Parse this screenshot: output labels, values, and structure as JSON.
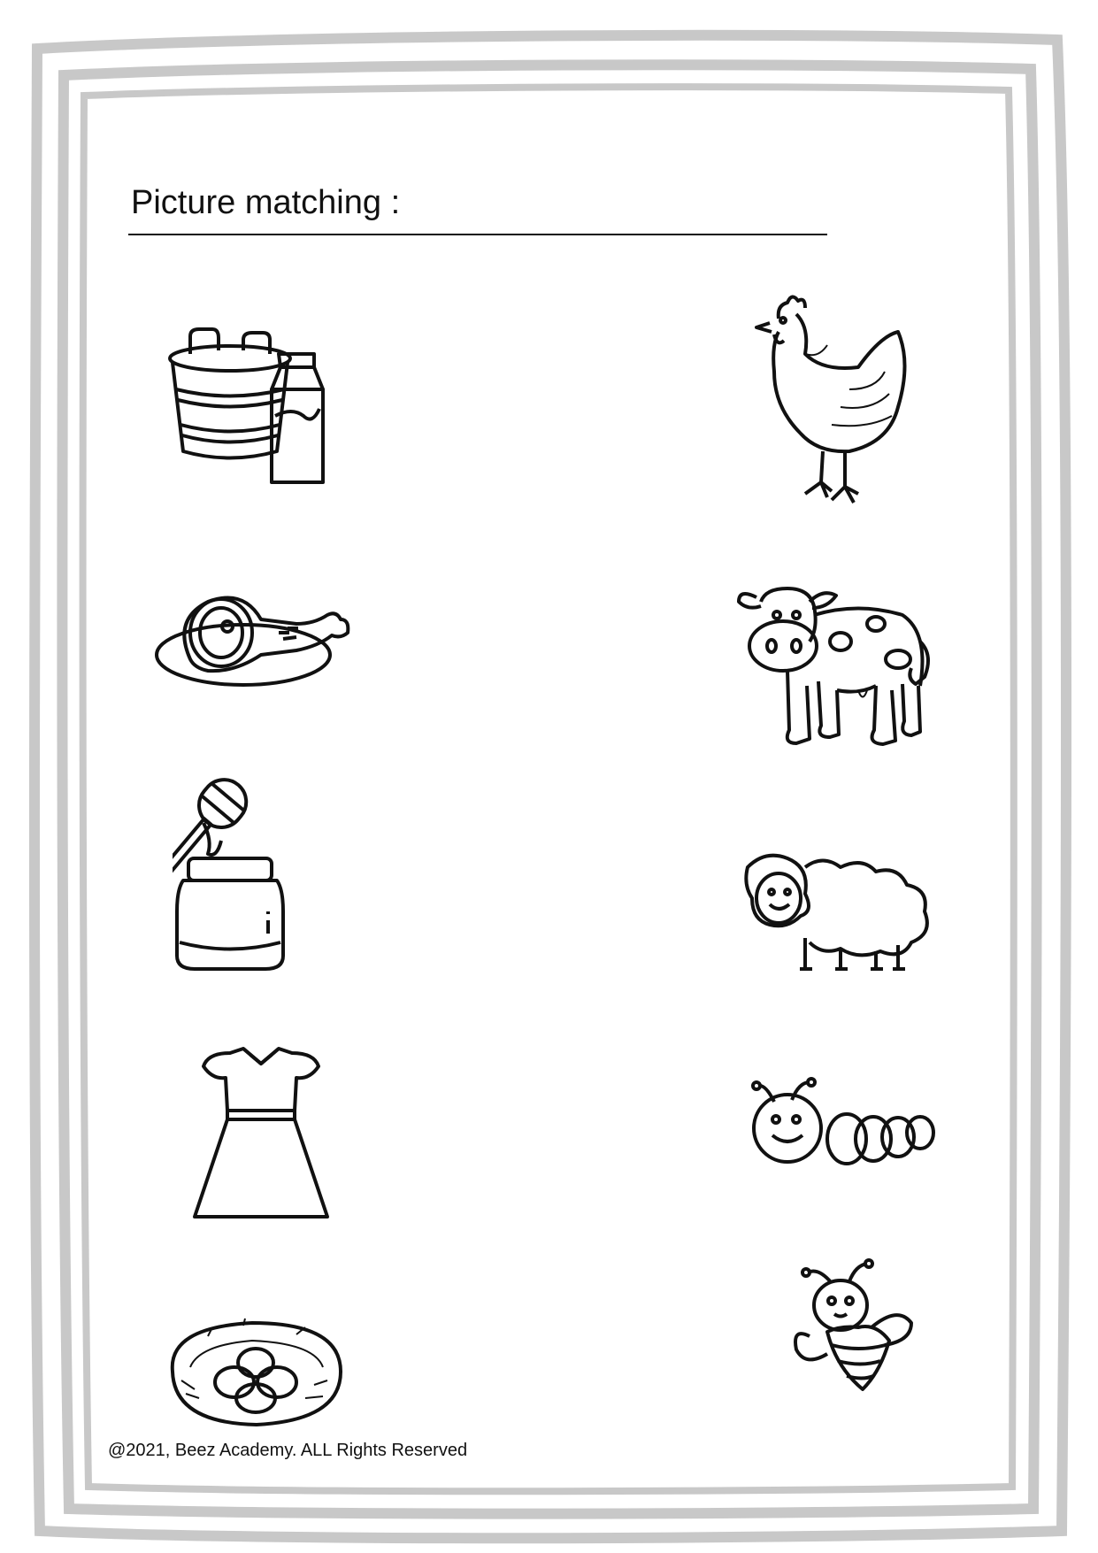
{
  "worksheet": {
    "title": "Picture matching :",
    "footer": "@2021, Beez Academy. ALL Rights Reserved"
  },
  "left_column": [
    {
      "icon": "milk-bucket-and-carton-icon"
    },
    {
      "icon": "ham-on-plate-icon"
    },
    {
      "icon": "honey-jar-and-dipper-icon"
    },
    {
      "icon": "dress-icon"
    },
    {
      "icon": "eggs-in-nest-icon"
    }
  ],
  "right_column": [
    {
      "icon": "hen-icon"
    },
    {
      "icon": "cow-icon"
    },
    {
      "icon": "sheep-icon"
    },
    {
      "icon": "caterpillar-icon"
    },
    {
      "icon": "bee-icon"
    }
  ],
  "colors": {
    "frame": "#c8c8c8",
    "ink": "#111111",
    "paper": "#ffffff"
  }
}
